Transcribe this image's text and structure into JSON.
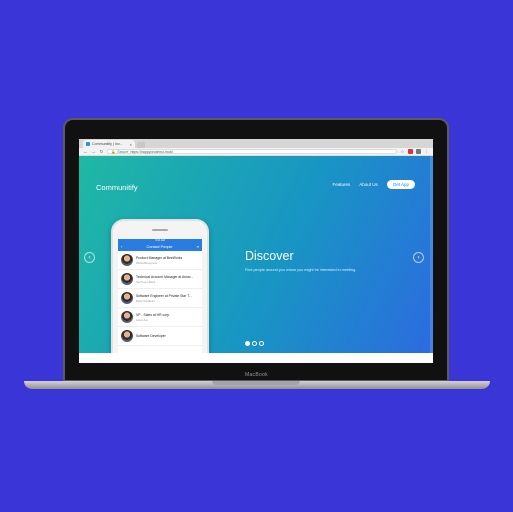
{
  "browser": {
    "tab_title": "Communitify | Inv...",
    "tab_close": "×",
    "url_secure": "Secure",
    "url": "https://happyorcdemo.mobi"
  },
  "site": {
    "brand": "Communitify",
    "nav": [
      "Features",
      "About Us"
    ],
    "cta": "Get App",
    "hero_title": "Discover",
    "hero_subtitle": "Find people around you whom you might be interested in meeting.",
    "prev": "‹",
    "next": "›"
  },
  "phone": {
    "status": "9:41 AM",
    "header_title": "Contact People",
    "contacts": [
      {
        "title": "Product Manager  at BeeWorks",
        "company": "Works/Boogmeer"
      },
      {
        "title": "Technical Account Manager at Amaz...",
        "company": "SeyToven Bank"
      },
      {
        "title": "Software Engineer  at Private Star T...",
        "company": "Beal Cloudless"
      },
      {
        "title": "VP - Sales at HR corp.",
        "company": "Accel Acc"
      },
      {
        "title": "Software Developer",
        "company": ""
      }
    ]
  },
  "device": {
    "label": "MacBook"
  },
  "colors": {
    "background": "#3a35d6",
    "gradient_start": "#1fb8a4",
    "gradient_end": "#2c6be0",
    "app_blue": "#2a7de0"
  }
}
